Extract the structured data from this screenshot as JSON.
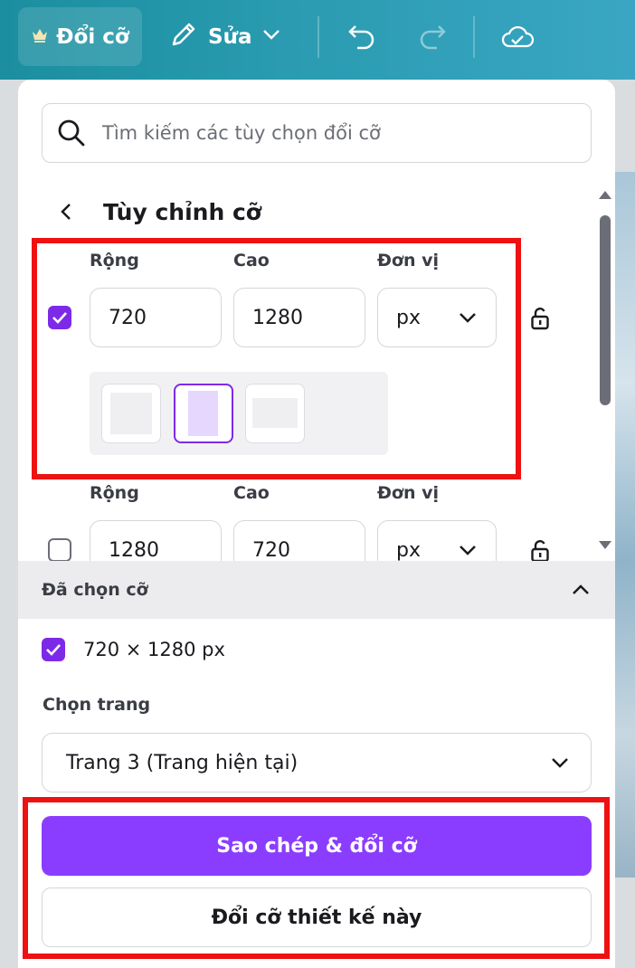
{
  "toolbar": {
    "resize_label": "Đổi cỡ",
    "edit_label": "Sửa"
  },
  "search": {
    "placeholder": "Tìm kiếm các tùy chọn đổi cỡ"
  },
  "custom_size": {
    "title": "Tùy chỉnh cỡ",
    "rows": [
      {
        "checked": true,
        "width_label": "Rộng",
        "height_label": "Cao",
        "unit_label": "Đơn vị",
        "width": "720",
        "height": "1280",
        "unit": "px"
      },
      {
        "checked": false,
        "width_label": "Rộng",
        "height_label": "Cao",
        "unit_label": "Đơn vị",
        "width": "1280",
        "height": "720",
        "unit": "px"
      }
    ]
  },
  "selected": {
    "header": "Đã chọn cỡ",
    "items": [
      "720 × 1280 px"
    ]
  },
  "page": {
    "label": "Chọn trang",
    "value": "Trang 3 (Trang hiện tại)"
  },
  "actions": {
    "primary": "Sao chép & đổi cỡ",
    "secondary": "Đổi cỡ thiết kế này"
  },
  "colors": {
    "accent": "#8b3dff",
    "checkbox": "#7d2ae8",
    "highlight": "#ee1111",
    "toolbar": "#1b8e9f"
  }
}
